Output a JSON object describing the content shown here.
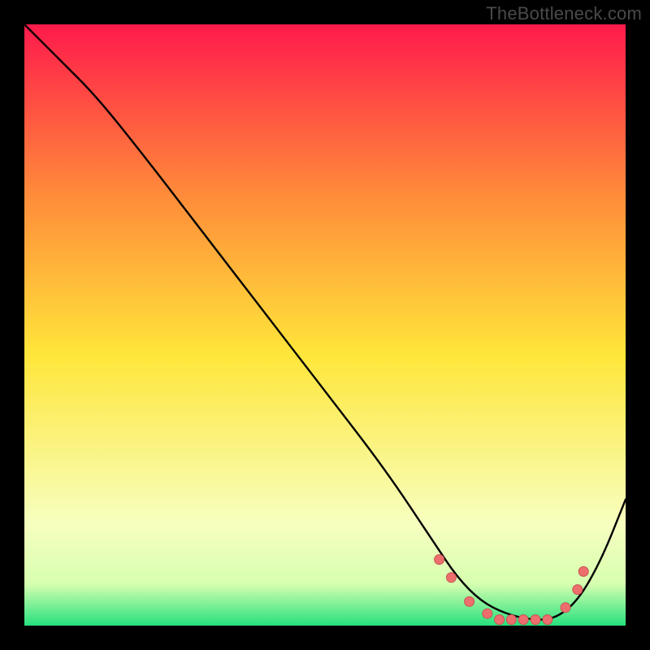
{
  "watermark": "TheBottleneck.com",
  "colors": {
    "frame": "#000000",
    "curve": "#000000",
    "marker_fill": "#ed6f6d",
    "marker_stroke": "#c75452",
    "grad_top": "#ff1a4b",
    "grad_mid1": "#ff8a3a",
    "grad_mid2": "#ffe63a",
    "grad_pale": "#f7ffbf",
    "grad_green": "#27e07e"
  },
  "chart_data": {
    "type": "line",
    "title": "",
    "xlabel": "",
    "ylabel": "",
    "xlim": [
      0,
      100
    ],
    "ylim": [
      0,
      100
    ],
    "series": [
      {
        "name": "bottleneck-curve",
        "x": [
          0,
          6,
          12,
          20,
          30,
          40,
          50,
          60,
          68,
          72,
          76,
          80,
          84,
          88,
          92,
          96,
          100
        ],
        "y": [
          100,
          94,
          88,
          78,
          65,
          52,
          39,
          26,
          14,
          8,
          4,
          2,
          1,
          1,
          4,
          11,
          21
        ]
      }
    ],
    "markers": {
      "name": "highlight-points",
      "x": [
        69,
        71,
        74,
        77,
        79,
        81,
        83,
        85,
        87,
        90,
        92,
        93
      ],
      "y": [
        11,
        8,
        4,
        2,
        1,
        1,
        1,
        1,
        1,
        3,
        6,
        9
      ]
    }
  }
}
